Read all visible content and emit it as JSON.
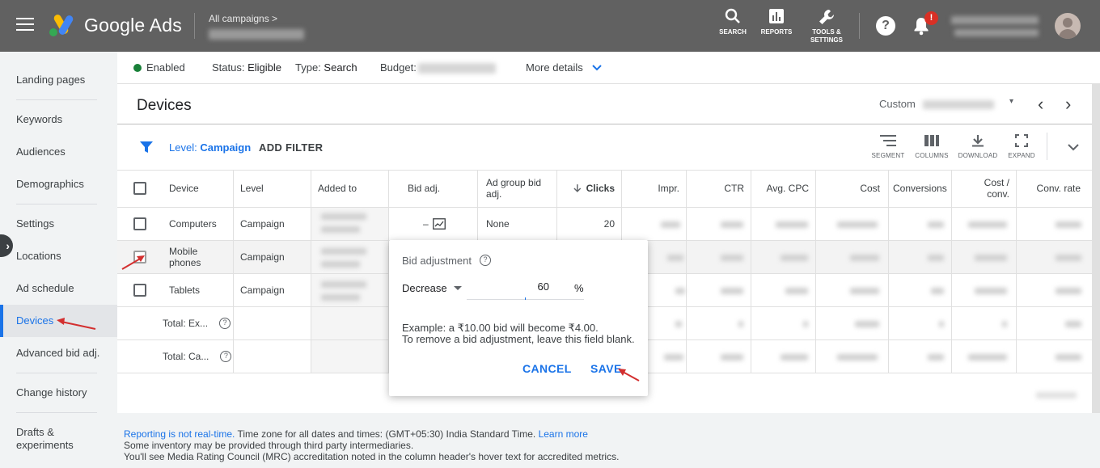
{
  "topbar": {
    "brand": "Google Ads",
    "breadcrumb": "All campaigns  >",
    "actions": [
      {
        "label": "SEARCH",
        "icon": "search-icon"
      },
      {
        "label": "REPORTS",
        "icon": "reports-icon"
      },
      {
        "label": "TOOLS &\nSETTINGS",
        "icon": "wrench-icon"
      }
    ],
    "help": "?",
    "notification_badge": "!"
  },
  "sidebar": {
    "items": [
      {
        "label": "Landing pages",
        "name": "sidebar-item-landing-pages"
      },
      {
        "label": "Keywords",
        "name": "sidebar-item-keywords"
      },
      {
        "label": "Audiences",
        "name": "sidebar-item-audiences"
      },
      {
        "label": "Demographics",
        "name": "sidebar-item-demographics"
      },
      {
        "label": "Settings",
        "name": "sidebar-item-settings"
      },
      {
        "label": "Locations",
        "name": "sidebar-item-locations"
      },
      {
        "label": "Ad schedule",
        "name": "sidebar-item-ad-schedule"
      },
      {
        "label": "Devices",
        "name": "sidebar-item-devices"
      },
      {
        "label": "Advanced bid adj.",
        "name": "sidebar-item-advanced-bid-adj"
      },
      {
        "label": "Change history",
        "name": "sidebar-item-change-history"
      },
      {
        "label": "Drafts &\nexperiments",
        "name": "sidebar-item-drafts-experiments"
      }
    ],
    "active": "Devices"
  },
  "status_bar": {
    "enabled": "Enabled",
    "status_label": "Status:",
    "status_value": "Eligible",
    "type_label": "Type:",
    "type_value": "Search",
    "budget_label": "Budget:",
    "more_details": "More details"
  },
  "page": {
    "title": "Devices",
    "date_range_label": "Custom"
  },
  "filter_bar": {
    "level_label": "Level:",
    "level_value": "Campaign",
    "add_filter": "ADD FILTER",
    "tools": [
      "SEGMENT",
      "COLUMNS",
      "DOWNLOAD",
      "EXPAND"
    ]
  },
  "table": {
    "columns": [
      "Device",
      "Level",
      "Added to",
      "Bid adj.",
      "Ad group bid\nadj.",
      "Clicks",
      "Impr.",
      "CTR",
      "Avg. CPC",
      "Cost",
      "Conversions",
      "Cost /\nconv.",
      "Conv. rate"
    ],
    "sort_column": "Clicks",
    "rows": [
      {
        "device": "Computers",
        "level": "Campaign",
        "bid_adj": "–",
        "ad_group_bid_adj": "None",
        "clicks": "20"
      },
      {
        "device": "Mobile\nphones",
        "level": "Campaign",
        "bid_adj": "",
        "ad_group_bid_adj": "",
        "clicks": ""
      },
      {
        "device": "Tablets",
        "level": "Campaign",
        "bid_adj": "",
        "ad_group_bid_adj": "",
        "clicks": ""
      }
    ],
    "totals": [
      {
        "label": "Total: Ex..."
      },
      {
        "label": "Total: Ca..."
      }
    ]
  },
  "bid_popup": {
    "title": "Bid adjustment",
    "direction": "Decrease",
    "value": "60",
    "unit": "%",
    "example_line1": "Example: a ₹10.00 bid will become ₹4.00.",
    "example_line2": "To remove a bid adjustment, leave this field blank.",
    "cancel": "CANCEL",
    "save": "SAVE"
  },
  "footer": {
    "reporting_link": "Reporting is not real-time.",
    "timezone": " Time zone for all dates and times: (GMT+05:30) India Standard Time. ",
    "learn_more": "Learn more",
    "line2": "Some inventory may be provided through third party intermediaries.",
    "line3": "You'll see Media Rating Council (MRC) accreditation noted in the column header's hover text for accredited metrics."
  },
  "colors": {
    "topbar": "#616161",
    "accent": "#1a73e8",
    "enabled_dot": "#188038",
    "annotation_arrow": "#d32f2f",
    "badge": "#d93025"
  }
}
